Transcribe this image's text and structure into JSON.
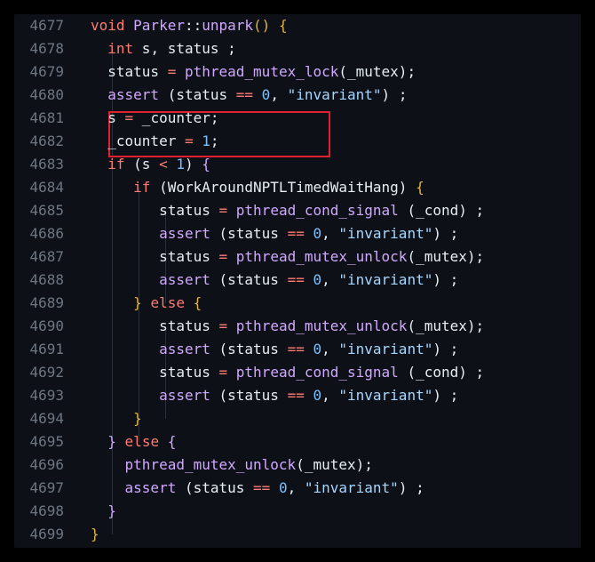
{
  "colors": {
    "background": "#0d1117",
    "line_number": "#6e7681",
    "text": "#e6edf3",
    "keyword": "#ff7b72",
    "function": "#d2a8ff",
    "number": "#79c0ff",
    "string": "#a5d6ff",
    "highlight_box": "#e0202f"
  },
  "editor": {
    "lines": [
      {
        "num": "4677",
        "tokens": [
          {
            "t": "void",
            "c": "kw"
          },
          {
            "t": " Parker",
            "c": "fn"
          },
          {
            "t": "::",
            "c": "plain"
          },
          {
            "t": "unpark",
            "c": "fn"
          },
          {
            "t": "()",
            "c": "br1"
          },
          {
            "t": " ",
            "c": "plain"
          },
          {
            "t": "{",
            "c": "br1"
          }
        ]
      },
      {
        "num": "4678",
        "tokens": [
          {
            "t": "  ",
            "c": "plain"
          },
          {
            "t": "int",
            "c": "ty"
          },
          {
            "t": " s, status ;",
            "c": "plain"
          }
        ]
      },
      {
        "num": "4679",
        "tokens": [
          {
            "t": "  status ",
            "c": "plain"
          },
          {
            "t": "=",
            "c": "op"
          },
          {
            "t": " ",
            "c": "plain"
          },
          {
            "t": "pthread_mutex_lock",
            "c": "fn"
          },
          {
            "t": "(_mutex);",
            "c": "plain"
          }
        ]
      },
      {
        "num": "4680",
        "tokens": [
          {
            "t": "  ",
            "c": "plain"
          },
          {
            "t": "assert",
            "c": "fn"
          },
          {
            "t": " (status ",
            "c": "plain"
          },
          {
            "t": "==",
            "c": "op"
          },
          {
            "t": " ",
            "c": "plain"
          },
          {
            "t": "0",
            "c": "num"
          },
          {
            "t": ", ",
            "c": "plain"
          },
          {
            "t": "\"invariant\"",
            "c": "str"
          },
          {
            "t": ") ;",
            "c": "plain"
          }
        ]
      },
      {
        "num": "4681",
        "tokens": [
          {
            "t": "  s ",
            "c": "plain"
          },
          {
            "t": "=",
            "c": "op"
          },
          {
            "t": " _counter;",
            "c": "plain"
          }
        ]
      },
      {
        "num": "4682",
        "tokens": [
          {
            "t": "  _counter ",
            "c": "plain"
          },
          {
            "t": "=",
            "c": "op"
          },
          {
            "t": " ",
            "c": "plain"
          },
          {
            "t": "1",
            "c": "num"
          },
          {
            "t": ";",
            "c": "plain"
          }
        ]
      },
      {
        "num": "4683",
        "tokens": [
          {
            "t": "  ",
            "c": "plain"
          },
          {
            "t": "if",
            "c": "kw"
          },
          {
            "t": " (s ",
            "c": "plain"
          },
          {
            "t": "<",
            "c": "op"
          },
          {
            "t": " ",
            "c": "plain"
          },
          {
            "t": "1",
            "c": "num"
          },
          {
            "t": ") ",
            "c": "plain"
          },
          {
            "t": "{",
            "c": "br2"
          }
        ]
      },
      {
        "num": "4684",
        "tokens": [
          {
            "t": "     ",
            "c": "plain"
          },
          {
            "t": "if",
            "c": "kw"
          },
          {
            "t": " (WorkAroundNPTLTimedWaitHang) ",
            "c": "plain"
          },
          {
            "t": "{",
            "c": "br3"
          }
        ]
      },
      {
        "num": "4685",
        "tokens": [
          {
            "t": "        status ",
            "c": "plain"
          },
          {
            "t": "=",
            "c": "op"
          },
          {
            "t": " ",
            "c": "plain"
          },
          {
            "t": "pthread_cond_signal",
            "c": "fn"
          },
          {
            "t": " (_cond) ;",
            "c": "plain"
          }
        ]
      },
      {
        "num": "4686",
        "tokens": [
          {
            "t": "        ",
            "c": "plain"
          },
          {
            "t": "assert",
            "c": "fn"
          },
          {
            "t": " (status ",
            "c": "plain"
          },
          {
            "t": "==",
            "c": "op"
          },
          {
            "t": " ",
            "c": "plain"
          },
          {
            "t": "0",
            "c": "num"
          },
          {
            "t": ", ",
            "c": "plain"
          },
          {
            "t": "\"invariant\"",
            "c": "str"
          },
          {
            "t": ") ;",
            "c": "plain"
          }
        ]
      },
      {
        "num": "4687",
        "tokens": [
          {
            "t": "        status ",
            "c": "plain"
          },
          {
            "t": "=",
            "c": "op"
          },
          {
            "t": " ",
            "c": "plain"
          },
          {
            "t": "pthread_mutex_unlock",
            "c": "fn"
          },
          {
            "t": "(_mutex);",
            "c": "plain"
          }
        ]
      },
      {
        "num": "4688",
        "tokens": [
          {
            "t": "        ",
            "c": "plain"
          },
          {
            "t": "assert",
            "c": "fn"
          },
          {
            "t": " (status ",
            "c": "plain"
          },
          {
            "t": "==",
            "c": "op"
          },
          {
            "t": " ",
            "c": "plain"
          },
          {
            "t": "0",
            "c": "num"
          },
          {
            "t": ", ",
            "c": "plain"
          },
          {
            "t": "\"invariant\"",
            "c": "str"
          },
          {
            "t": ") ;",
            "c": "plain"
          }
        ]
      },
      {
        "num": "4689",
        "tokens": [
          {
            "t": "     ",
            "c": "plain"
          },
          {
            "t": "}",
            "c": "br3"
          },
          {
            "t": " ",
            "c": "plain"
          },
          {
            "t": "else",
            "c": "kw"
          },
          {
            "t": " ",
            "c": "plain"
          },
          {
            "t": "{",
            "c": "br3"
          }
        ]
      },
      {
        "num": "4690",
        "tokens": [
          {
            "t": "        status ",
            "c": "plain"
          },
          {
            "t": "=",
            "c": "op"
          },
          {
            "t": " ",
            "c": "plain"
          },
          {
            "t": "pthread_mutex_unlock",
            "c": "fn"
          },
          {
            "t": "(_mutex);",
            "c": "plain"
          }
        ]
      },
      {
        "num": "4691",
        "tokens": [
          {
            "t": "        ",
            "c": "plain"
          },
          {
            "t": "assert",
            "c": "fn"
          },
          {
            "t": " (status ",
            "c": "plain"
          },
          {
            "t": "==",
            "c": "op"
          },
          {
            "t": " ",
            "c": "plain"
          },
          {
            "t": "0",
            "c": "num"
          },
          {
            "t": ", ",
            "c": "plain"
          },
          {
            "t": "\"invariant\"",
            "c": "str"
          },
          {
            "t": ") ;",
            "c": "plain"
          }
        ]
      },
      {
        "num": "4692",
        "tokens": [
          {
            "t": "        status ",
            "c": "plain"
          },
          {
            "t": "=",
            "c": "op"
          },
          {
            "t": " ",
            "c": "plain"
          },
          {
            "t": "pthread_cond_signal",
            "c": "fn"
          },
          {
            "t": " (_cond) ;",
            "c": "plain"
          }
        ]
      },
      {
        "num": "4693",
        "tokens": [
          {
            "t": "        ",
            "c": "plain"
          },
          {
            "t": "assert",
            "c": "fn"
          },
          {
            "t": " (status ",
            "c": "plain"
          },
          {
            "t": "==",
            "c": "op"
          },
          {
            "t": " ",
            "c": "plain"
          },
          {
            "t": "0",
            "c": "num"
          },
          {
            "t": ", ",
            "c": "plain"
          },
          {
            "t": "\"invariant\"",
            "c": "str"
          },
          {
            "t": ") ;",
            "c": "plain"
          }
        ]
      },
      {
        "num": "4694",
        "tokens": [
          {
            "t": "     ",
            "c": "plain"
          },
          {
            "t": "}",
            "c": "br3"
          }
        ]
      },
      {
        "num": "4695",
        "tokens": [
          {
            "t": "  ",
            "c": "plain"
          },
          {
            "t": "}",
            "c": "br2"
          },
          {
            "t": " ",
            "c": "plain"
          },
          {
            "t": "else",
            "c": "kw"
          },
          {
            "t": " ",
            "c": "plain"
          },
          {
            "t": "{",
            "c": "br2"
          }
        ]
      },
      {
        "num": "4696",
        "tokens": [
          {
            "t": "    ",
            "c": "plain"
          },
          {
            "t": "pthread_mutex_unlock",
            "c": "fn"
          },
          {
            "t": "(_mutex);",
            "c": "plain"
          }
        ]
      },
      {
        "num": "4697",
        "tokens": [
          {
            "t": "    ",
            "c": "plain"
          },
          {
            "t": "assert",
            "c": "fn"
          },
          {
            "t": " (status ",
            "c": "plain"
          },
          {
            "t": "==",
            "c": "op"
          },
          {
            "t": " ",
            "c": "plain"
          },
          {
            "t": "0",
            "c": "num"
          },
          {
            "t": ", ",
            "c": "plain"
          },
          {
            "t": "\"invariant\"",
            "c": "str"
          },
          {
            "t": ") ;",
            "c": "plain"
          }
        ]
      },
      {
        "num": "4698",
        "tokens": [
          {
            "t": "  ",
            "c": "plain"
          },
          {
            "t": "}",
            "c": "br2"
          }
        ]
      },
      {
        "num": "4699",
        "tokens": [
          {
            "t": "}",
            "c": "br1"
          }
        ]
      }
    ]
  }
}
